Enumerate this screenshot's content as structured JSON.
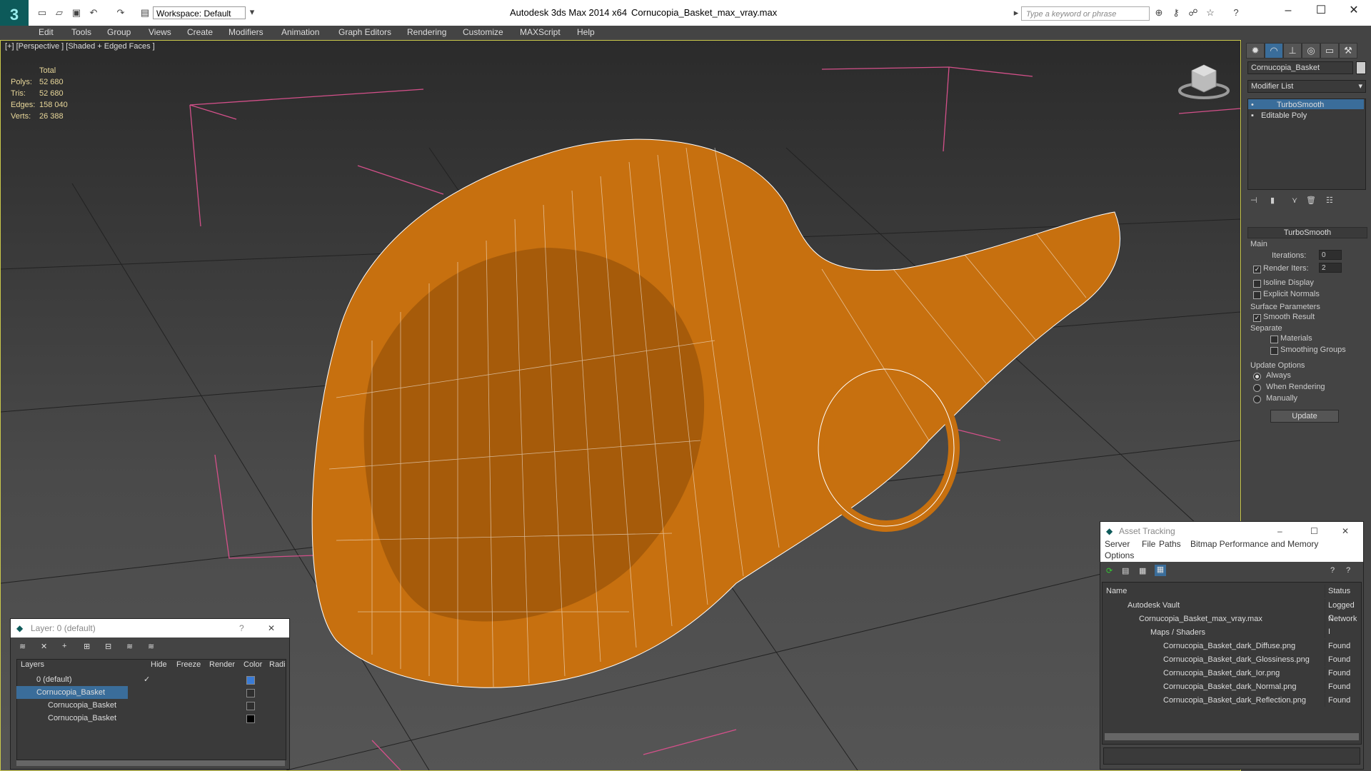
{
  "titlebar": {
    "app_title": "Autodesk 3ds Max  2014 x64",
    "file_title": "Cornucopia_Basket_max_vray.max",
    "workspace": "Workspace: Default",
    "search_placeholder": "Type a keyword or phrase"
  },
  "menus": [
    "Edit",
    "Tools",
    "Group",
    "Views",
    "Create",
    "Modifiers",
    "Animation",
    "Graph Editors",
    "Rendering",
    "Customize",
    "MAXScript",
    "Help"
  ],
  "viewport": {
    "label": "[+] [Perspective ] [Shaded + Edged Faces ]",
    "stats": {
      "header": "Total",
      "rows": [
        {
          "k": "Polys:",
          "v": "52 680"
        },
        {
          "k": "Tris:",
          "v": "52 680"
        },
        {
          "k": "Edges:",
          "v": "158 040"
        },
        {
          "k": "Verts:",
          "v": "26 388"
        }
      ]
    },
    "colors": {
      "wood": "#c7700f",
      "edge": "#ffffff",
      "box": "#d4508a",
      "highlight": "#cbc94b"
    }
  },
  "command_panel": {
    "object_name": "Cornucopia_Basket",
    "modifier_list": "Modifier List",
    "stack": [
      "TurboSmooth",
      "Editable Poly"
    ],
    "rollout_title": "TurboSmooth",
    "main_label": "Main",
    "iterations_label": "Iterations:",
    "iterations_value": "0",
    "render_iters_label": "Render Iters:",
    "render_iters_value": "2",
    "isoline": "Isoline Display",
    "explicit": "Explicit Normals",
    "surface_params": "Surface Parameters",
    "smooth_result": "Smooth Result",
    "separate": "Separate",
    "materials": "Materials",
    "smoothing_groups": "Smoothing Groups",
    "update_options": "Update Options",
    "always": "Always",
    "when_rendering": "When Rendering",
    "manually": "Manually",
    "update_btn": "Update"
  },
  "layer_panel": {
    "title": "Layer: 0 (default)",
    "help": "?",
    "columns": [
      "Layers",
      "Hide",
      "Freeze",
      "Render",
      "Color",
      "Radi"
    ],
    "rows": [
      {
        "name": "0 (default)",
        "color": "#3a7bd5",
        "selected": false,
        "indent": 1
      },
      {
        "name": "Cornucopia_Basket",
        "color": "#2e2e2e",
        "selected": true,
        "indent": 1
      },
      {
        "name": "Cornucopia_Basket",
        "color": "#2e2e2e",
        "selected": false,
        "indent": 2
      },
      {
        "name": "Cornucopia_Basket",
        "color": "#000000",
        "selected": false,
        "indent": 2
      }
    ]
  },
  "asset_panel": {
    "title": "Asset Tracking",
    "menu": [
      "Server",
      "File",
      "Paths",
      "Bitmap Performance and Memory",
      "Options"
    ],
    "col_name": "Name",
    "col_status": "Status",
    "rows": [
      {
        "name": "Autodesk Vault",
        "status": "Logged C",
        "indent": 1
      },
      {
        "name": "Cornucopia_Basket_max_vray.max",
        "status": "Network I",
        "indent": 2
      },
      {
        "name": "Maps / Shaders",
        "status": "",
        "indent": 3
      },
      {
        "name": "Cornucopia_Basket_dark_Diffuse.png",
        "status": "Found",
        "indent": 4
      },
      {
        "name": "Cornucopia_Basket_dark_Glossiness.png",
        "status": "Found",
        "indent": 4
      },
      {
        "name": "Cornucopia_Basket_dark_Ior.png",
        "status": "Found",
        "indent": 4
      },
      {
        "name": "Cornucopia_Basket_dark_Normal.png",
        "status": "Found",
        "indent": 4
      },
      {
        "name": "Cornucopia_Basket_dark_Reflection.png",
        "status": "Found",
        "indent": 4
      }
    ]
  }
}
